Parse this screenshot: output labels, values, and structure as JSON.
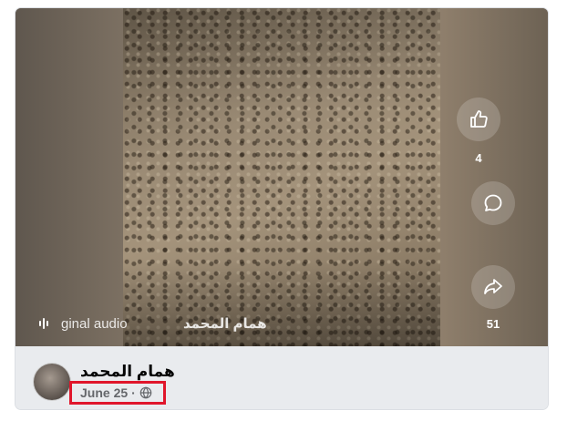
{
  "post": {
    "overlay_author": "همام المحمد",
    "audio_label": "ginal audio",
    "like_count": "4",
    "share_count": "51",
    "author_name": "همام المحمد",
    "date": "June 25",
    "separator": "·",
    "privacy_icon": "globe-icon"
  },
  "colors": {
    "highlight": "#e0162b",
    "meta_text": "#65676b"
  }
}
